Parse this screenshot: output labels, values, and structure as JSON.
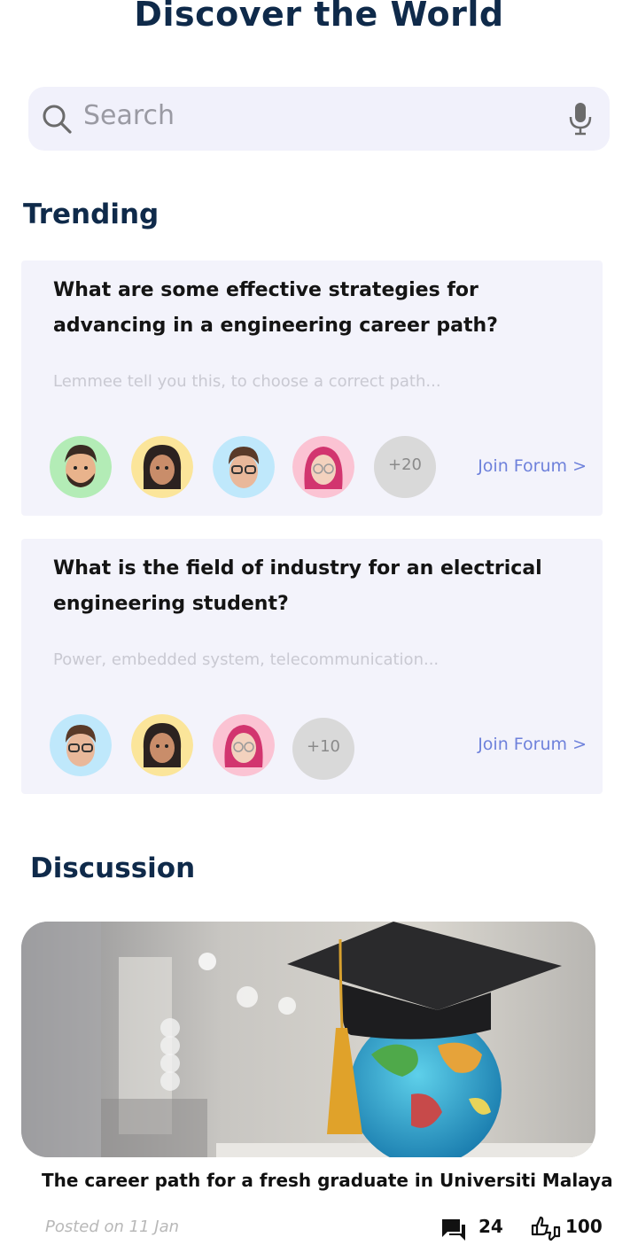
{
  "header": {
    "title": "Discover the World"
  },
  "search": {
    "placeholder": "Search"
  },
  "trending": {
    "title": "Trending",
    "cards": [
      {
        "question": "What are some effective strategies for advancing in a engineering career path?",
        "snippet": "Lemmee tell you this, to choose a correct path...",
        "more_count": "+20",
        "join_label": "Join Forum >"
      },
      {
        "question": "What is the field of industry for an electrical engineering student?",
        "snippet": "Power, embedded system, telecommunication...",
        "more_count": "+10",
        "join_label": "Join Forum >"
      }
    ]
  },
  "discussion": {
    "title": "Discussion",
    "post": {
      "title": "The career path for a fresh graduate in Universiti Malaya",
      "posted": "Posted on 11 Jan",
      "comments": "24",
      "likes": "100"
    }
  },
  "icons": [
    "search-icon",
    "mic-icon",
    "comment-icon",
    "like-dislike-icon"
  ],
  "colors": {
    "accent": "#6e81db",
    "title": "#0f2a4a",
    "card_bg": "#f3f3fb"
  }
}
